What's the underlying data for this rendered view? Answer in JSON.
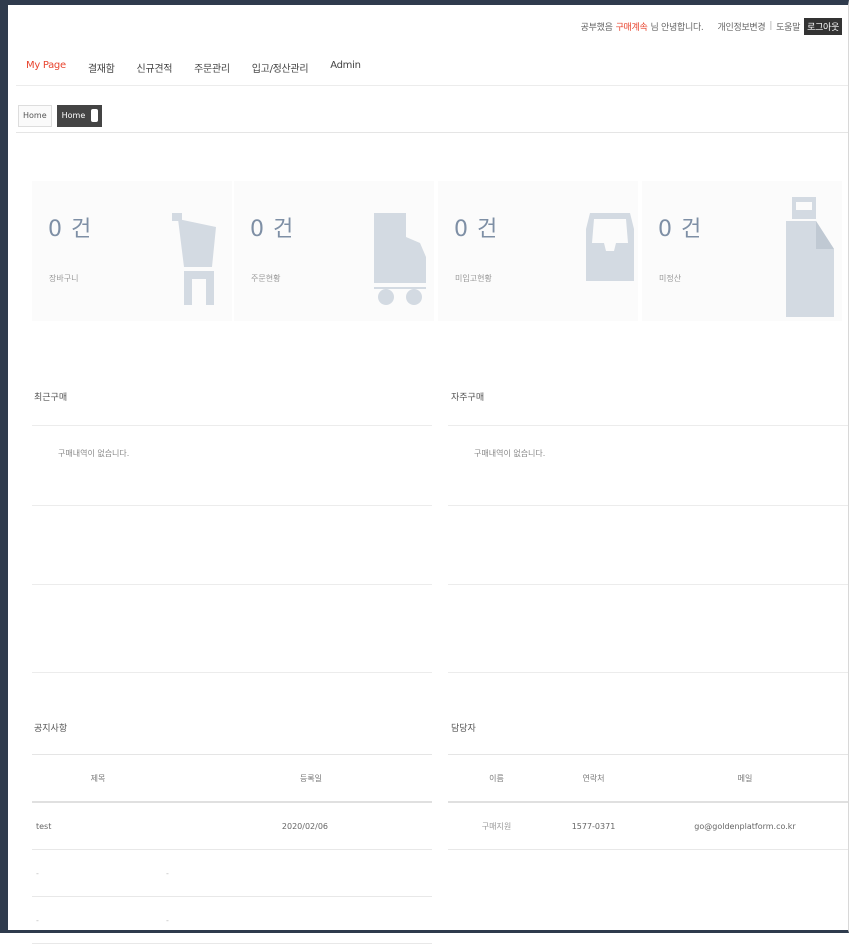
{
  "header": {
    "greeting_prefix": "공부했음",
    "user_name": "구매계속",
    "greeting_suffix": "님 안녕합니다.",
    "personal_info": "개인정보변경",
    "help": "도움말",
    "logout": "로그아웃"
  },
  "nav": {
    "items": [
      {
        "label": "My Page"
      },
      {
        "label": "결재함"
      },
      {
        "label": "신규견적"
      },
      {
        "label": "주문관리"
      },
      {
        "label": "입고/정산관리"
      },
      {
        "label": "Admin"
      }
    ]
  },
  "tabs": [
    {
      "label": "Home"
    },
    {
      "label": "Home"
    }
  ],
  "stats": [
    {
      "count": "0 건",
      "label": "장바구니",
      "icon": "cart-icon"
    },
    {
      "count": "0 건",
      "label": "주문현황",
      "icon": "truck-icon"
    },
    {
      "count": "0 건",
      "label": "미입고현황",
      "icon": "inbox-icon"
    },
    {
      "count": "0 건",
      "label": "미정산",
      "icon": "receipt-icon"
    }
  ],
  "recent_purchase": {
    "title": "최근구매",
    "empty": "구매내역이 없습니다."
  },
  "frequent_purchase": {
    "title": "자주구매",
    "empty": "구매내역이 없습니다."
  },
  "notice": {
    "title": "공지사항",
    "columns": [
      "제목",
      "등록일"
    ],
    "rows": [
      {
        "title": "test",
        "date": "2020/02/06"
      },
      {
        "title": "-",
        "date": "-"
      },
      {
        "title": "-",
        "date": "-"
      }
    ]
  },
  "contact": {
    "title": "담당자",
    "columns": [
      "이름",
      "연락처",
      "메일"
    ],
    "rows": [
      {
        "name": "구매지원",
        "phone": "1577-0371",
        "email": "go@goldenplatform.co.kr"
      }
    ]
  },
  "colors": {
    "accent": "#e8452f",
    "frame": "#2f3b4d",
    "icon": "#d3dae2",
    "count": "#7e8fa5"
  }
}
